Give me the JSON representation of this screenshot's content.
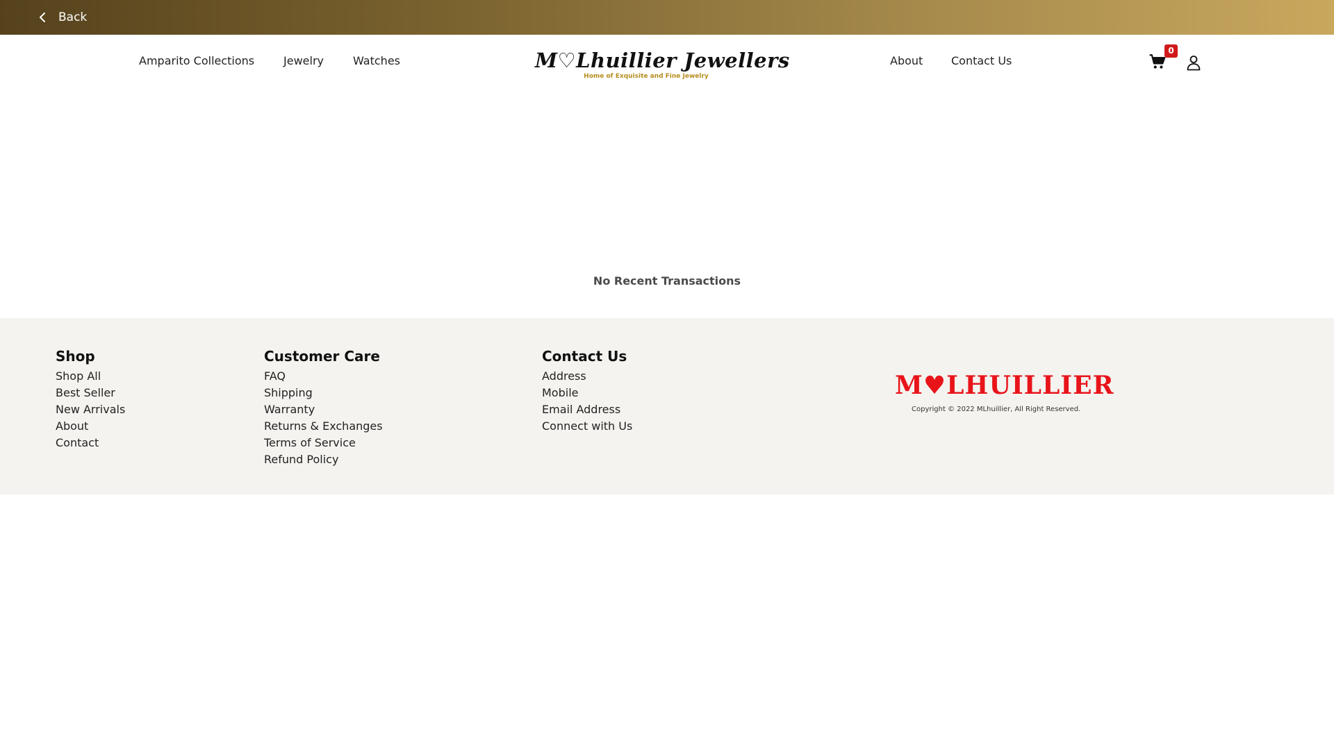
{
  "topbar": {
    "back_label": "Back",
    "gradient_colors": [
      "#55421c",
      "#c9a85d"
    ]
  },
  "header": {
    "nav_left": [
      "Amparito Collections",
      "Jewelry",
      "Watches"
    ],
    "nav_right": [
      "About",
      "Contact Us"
    ],
    "brand_name": "M♡Lhuillier Jewellers",
    "brand_tagline": "Home of Exquisite and Fine Jewelry",
    "cart_count": "0",
    "cart_icon": "shopping-cart-icon",
    "user_icon": "user-icon"
  },
  "main": {
    "empty_message": "No Recent Transactions"
  },
  "footer": {
    "shop": {
      "title": "Shop",
      "links": [
        "Shop All",
        "Best Seller",
        "New Arrivals",
        "About",
        "Contact"
      ]
    },
    "customer_care": {
      "title": "Customer Care",
      "links": [
        "FAQ",
        "Shipping",
        "Warranty",
        "Returns & Exchanges",
        "Terms of Service",
        "Refund Policy"
      ]
    },
    "contact": {
      "title": "Contact Us",
      "links": [
        "Address",
        "Mobile",
        "Email Address",
        "Connect with Us"
      ]
    },
    "brand_logo_text": "M♥LHUILLIER",
    "copyright": "Copyright © 2022 MLhuillier, All Right Reserved."
  },
  "colors": {
    "brand_red": "#e8141a",
    "gold_tagline": "#b58e1e",
    "footer_bg": "#f4f3ef",
    "badge_red": "#d11a1a"
  }
}
